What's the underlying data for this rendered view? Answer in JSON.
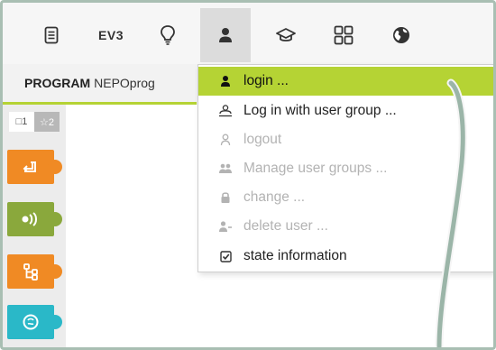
{
  "toolbar": {
    "items": [
      {
        "name": "program-icon"
      },
      {
        "name": "robot-ev3",
        "label": "EV3"
      },
      {
        "name": "lightbulb-icon"
      },
      {
        "name": "user-icon"
      },
      {
        "name": "graduation-cap-icon"
      },
      {
        "name": "gallery-grid-icon"
      },
      {
        "name": "globe-icon"
      }
    ]
  },
  "tabs": {
    "program_label": "PROGRAM",
    "program_name": "NEPOprog"
  },
  "palette": {
    "tabs": [
      {
        "label": "□1"
      },
      {
        "label": "☆2"
      }
    ],
    "blocks": [
      {
        "name": "action-block",
        "color": "#f08a24"
      },
      {
        "name": "sensor-block",
        "color": "#8aa83c"
      },
      {
        "name": "control-block",
        "color": "#f08a24"
      },
      {
        "name": "logic-block",
        "color": "#2ab8c8"
      }
    ]
  },
  "user_menu": {
    "items": [
      {
        "label": "login ...",
        "enabled": true,
        "highlighted": true,
        "icon": "user-icon"
      },
      {
        "label": "Log in with user group ...",
        "enabled": true,
        "icon": "user-group-icon"
      },
      {
        "label": "logout",
        "enabled": false,
        "icon": "logout-icon"
      },
      {
        "label": "Manage user groups ...",
        "enabled": false,
        "icon": "manage-groups-icon"
      },
      {
        "label": "change ...",
        "enabled": false,
        "icon": "lock-icon"
      },
      {
        "label": "delete user ...",
        "enabled": false,
        "icon": "delete-user-icon"
      },
      {
        "label": "state information",
        "enabled": true,
        "icon": "checkbox-icon"
      }
    ]
  },
  "colors": {
    "highlight": "#b5d334",
    "frame": "#a9bfb3",
    "annotation_arrow": "#9bb5a8"
  }
}
